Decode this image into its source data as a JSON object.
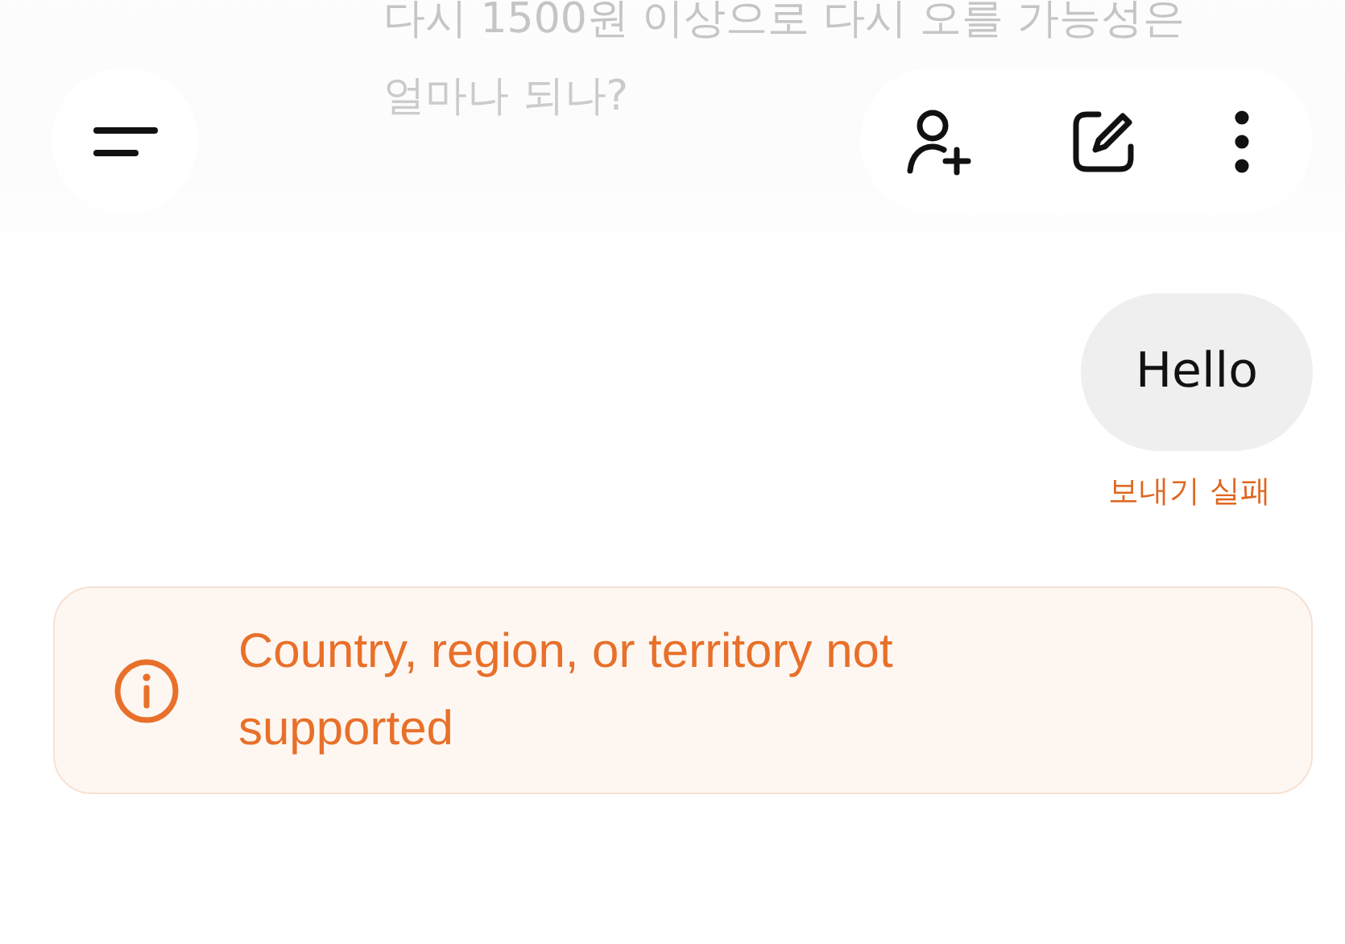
{
  "earlier_message": {
    "text": "다시 1500원 이상으로 다시 오를 가능성은 얼마나 되나?"
  },
  "messages": [
    {
      "text": "Hello",
      "status": "보내기 실패"
    }
  ],
  "notice": {
    "kind": "warning",
    "text": "Country, region, or territory not supported"
  }
}
